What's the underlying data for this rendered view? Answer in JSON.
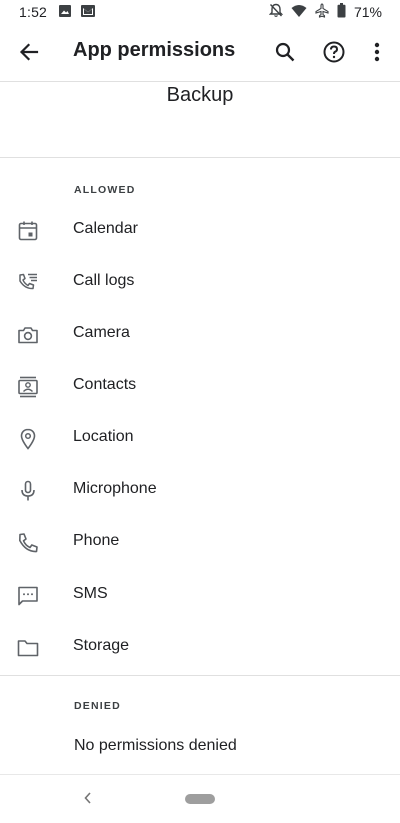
{
  "status_bar": {
    "time": "1:52",
    "battery": "71%",
    "left_icons": [
      "image-icon",
      "gmail-icon"
    ],
    "right_icons": [
      "notifications-off-icon",
      "wifi-icon",
      "airplane-icon",
      "battery-icon"
    ]
  },
  "toolbar": {
    "title": "App permissions",
    "back_icon": "arrow-back-icon",
    "actions": [
      "search-icon",
      "help-icon",
      "more-vert-icon"
    ]
  },
  "app": {
    "name": "Backup"
  },
  "allowed": {
    "header": "ALLOWED",
    "items": [
      {
        "label": "Calendar",
        "icon": "calendar-icon"
      },
      {
        "label": "Call logs",
        "icon": "call-log-icon"
      },
      {
        "label": "Camera",
        "icon": "camera-icon"
      },
      {
        "label": "Contacts",
        "icon": "contacts-icon"
      },
      {
        "label": "Location",
        "icon": "location-icon"
      },
      {
        "label": "Microphone",
        "icon": "microphone-icon"
      },
      {
        "label": "Phone",
        "icon": "phone-icon"
      },
      {
        "label": "SMS",
        "icon": "sms-icon"
      },
      {
        "label": "Storage",
        "icon": "folder-icon"
      }
    ]
  },
  "denied": {
    "header": "DENIED",
    "empty_text": "No permissions denied"
  },
  "nav_bar": {
    "back_icon": "nav-back-icon",
    "home_icon": "home-pill-icon"
  },
  "colors": {
    "text": "#202124",
    "icon": "#5f6368",
    "divider": "#e0e0e0"
  }
}
